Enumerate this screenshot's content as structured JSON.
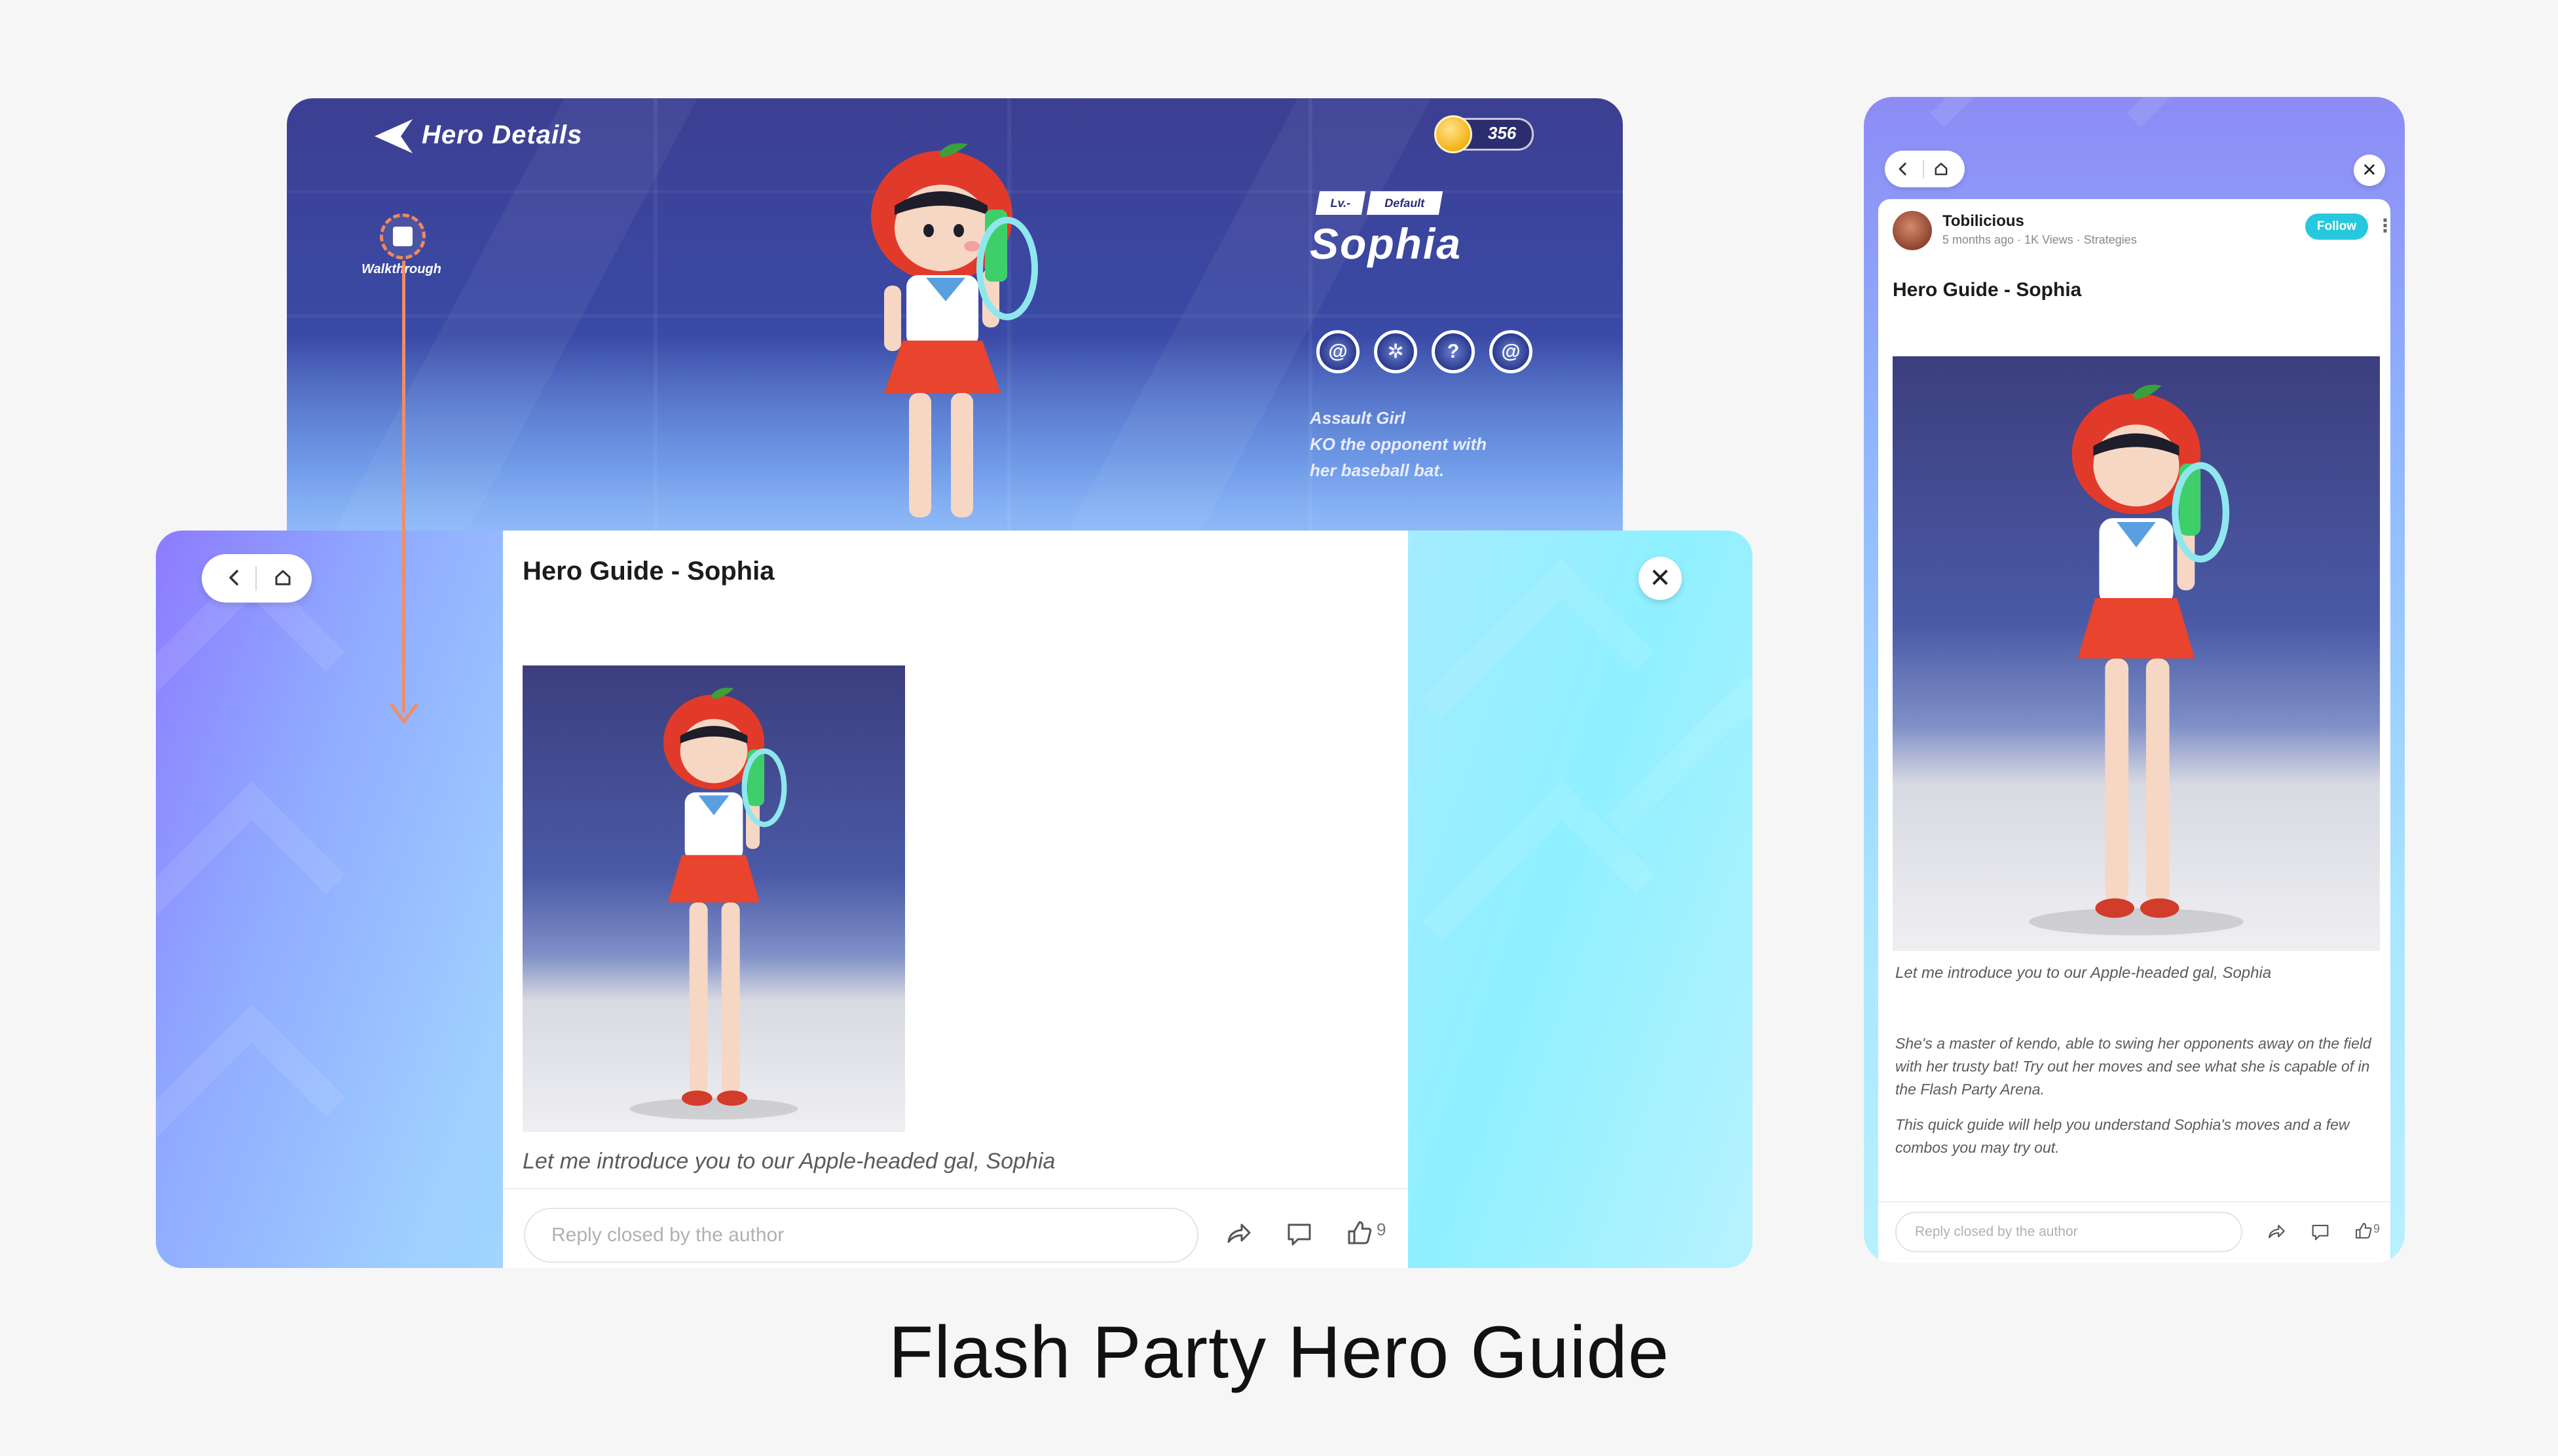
{
  "game": {
    "title": "Hero Details",
    "coins": "356",
    "walkthrough_label": "Walkthrough",
    "level_badge": "Lv.-",
    "default_badge": "Default",
    "hero_name": "Sophia",
    "skills": [
      "@",
      "✲",
      "?",
      "@"
    ],
    "description_lines": [
      "Assault Girl",
      "KO the opponent with",
      "her baseball bat."
    ]
  },
  "guide": {
    "title": "Hero Guide - Sophia",
    "caption": "Let me introduce you to our Apple-headed gal, Sophia",
    "reply_placeholder": "Reply closed by the author",
    "like_count": "9",
    "close_glyph": "✕"
  },
  "phone": {
    "author": "Tobilicious",
    "meta": "5 months ago · 1K Views · Strategies",
    "follow_label": "Follow",
    "more_glyph": "⋮",
    "title": "Hero Guide - Sophia",
    "caption": "Let me introduce you to our Apple-headed gal, Sophia",
    "body1": "She's a master of kendo, able to swing her opponents away on the field with her trusty bat! Try out her moves and see what she is capable of in the Flash Party Arena.",
    "body2": "This quick guide will help you understand Sophia's moves and a few combos you may try out.",
    "reply_placeholder": "Reply closed by the author",
    "like_count": "9",
    "close_glyph": "✕"
  },
  "page_caption": "Flash Party Hero Guide",
  "colors": {
    "accent_follow": "#27c8de",
    "flow_arrow": "#ef8d68",
    "game_bg": "#3c3f92"
  },
  "icons": [
    "back-arrow-icon",
    "coin-icon",
    "walkthrough-icon",
    "skill-icon",
    "chevron-left-icon",
    "home-icon",
    "close-icon",
    "share-icon",
    "comment-icon",
    "thumbs-up-icon",
    "more-icon"
  ]
}
